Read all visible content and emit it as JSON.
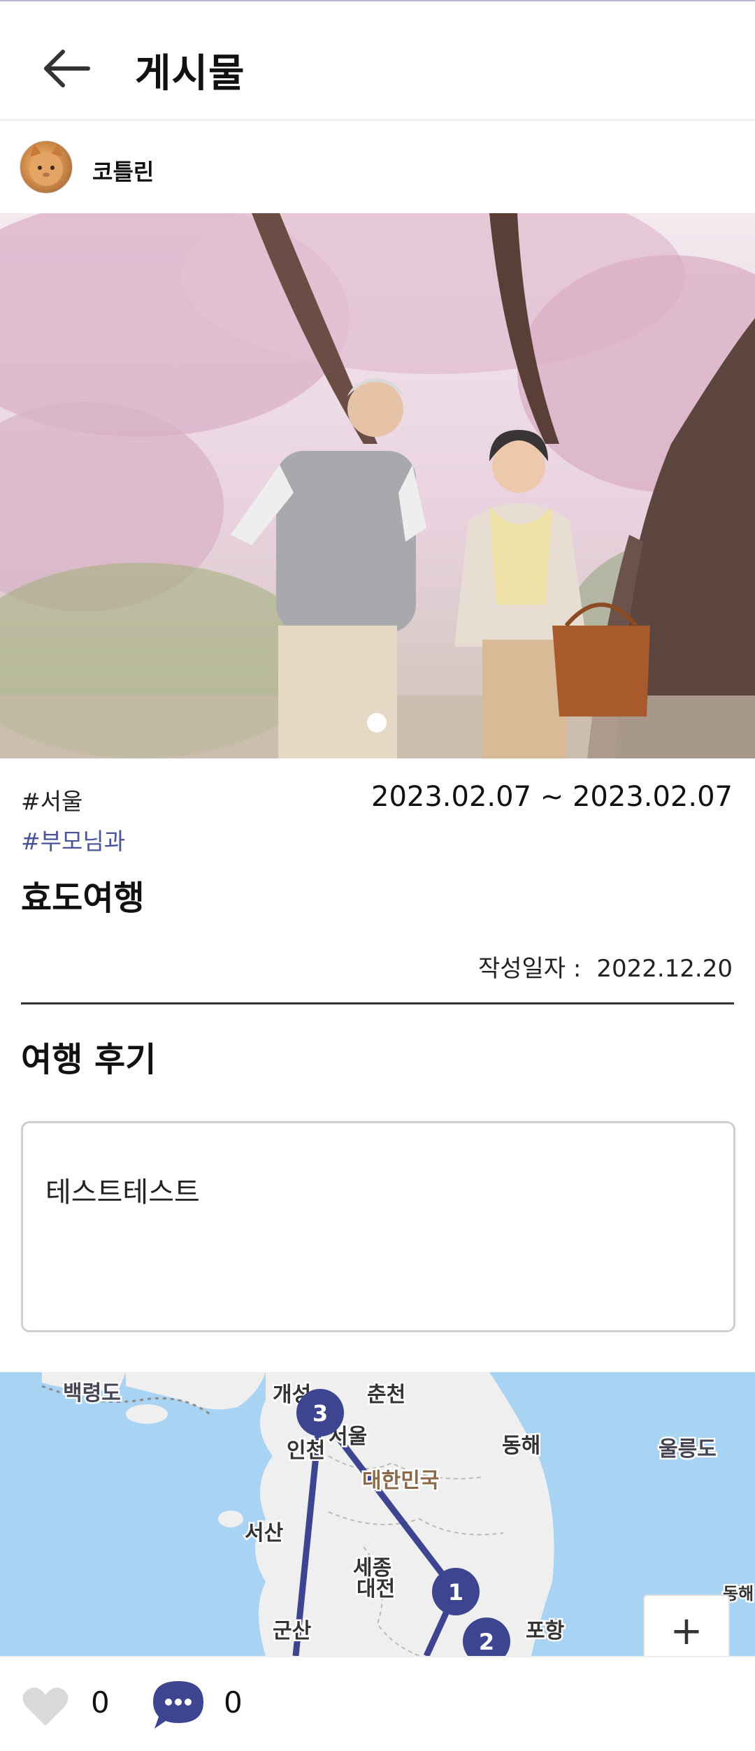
{
  "header": {
    "title": "게시물"
  },
  "author": {
    "name": "코틀린"
  },
  "post": {
    "tags": [
      "#서울",
      "#부모님과"
    ],
    "date_range": "2023.02.07 ~ 2023.02.07",
    "title": "효도여행",
    "written_label": "작성일자 :",
    "written_date": "2022.12.20"
  },
  "review": {
    "section_title": "여행 후기",
    "text": "테스트테스트"
  },
  "map": {
    "labels": [
      "백령도",
      "개성",
      "춘천",
      "서울",
      "인천",
      "동해",
      "울릉도",
      "대한민국",
      "서산",
      "세종",
      "대전",
      "군산",
      "포항",
      "동해"
    ],
    "markers": [
      "3",
      "1",
      "2"
    ],
    "zoom_in": "+"
  },
  "footer": {
    "like_count": "0",
    "comment_count": "0"
  },
  "colors": {
    "accent": "#3d4590",
    "tag": "#4a5599",
    "water": "#a9d3f2",
    "land": "#efefef"
  }
}
